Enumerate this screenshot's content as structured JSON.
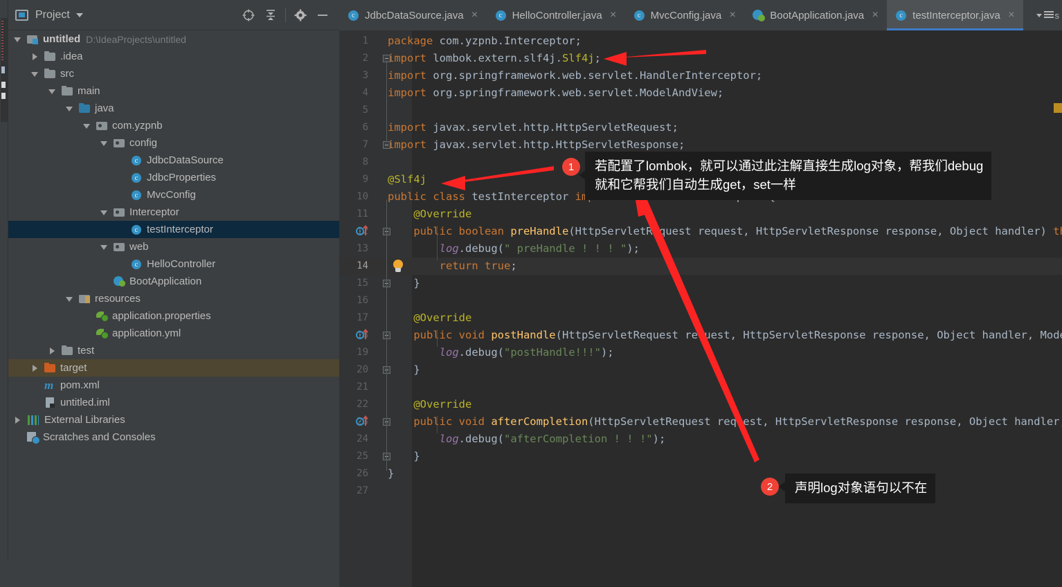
{
  "window": {
    "left_tool_strip_label": "Project"
  },
  "project_panel": {
    "title": "Project",
    "caret_icon": "chevron-down-icon",
    "panel_icon": "project-view-icon",
    "tools": [
      {
        "name": "locate-icon",
        "glyph": "locate"
      },
      {
        "name": "collapse-all-icon",
        "glyph": "collapse"
      },
      {
        "name": "gear-icon",
        "glyph": "gear"
      },
      {
        "name": "minimize-icon",
        "glyph": "minus"
      }
    ],
    "tree": [
      {
        "label": "untitled",
        "sub": "D:\\IdeaProjects\\untitled",
        "indent": 0,
        "arrow": "open",
        "icon": "proj",
        "bold": true,
        "state": "normal"
      },
      {
        "label": ".idea",
        "sub": "",
        "indent": 1,
        "arrow": "closed",
        "icon": "folder",
        "bold": false,
        "state": "normal"
      },
      {
        "label": "src",
        "sub": "",
        "indent": 1,
        "arrow": "open",
        "icon": "folder",
        "bold": false,
        "state": "normal"
      },
      {
        "label": "main",
        "sub": "",
        "indent": 2,
        "arrow": "open",
        "icon": "folder",
        "bold": false,
        "state": "normal"
      },
      {
        "label": "java",
        "sub": "",
        "indent": 3,
        "arrow": "open",
        "icon": "folder-src",
        "bold": false,
        "state": "normal"
      },
      {
        "label": "com.yzpnb",
        "sub": "",
        "indent": 4,
        "arrow": "open",
        "icon": "package",
        "bold": false,
        "state": "normal"
      },
      {
        "label": "config",
        "sub": "",
        "indent": 5,
        "arrow": "open",
        "icon": "package",
        "bold": false,
        "state": "normal"
      },
      {
        "label": "JdbcDataSource",
        "sub": "",
        "indent": 6,
        "arrow": "none",
        "icon": "cls",
        "bold": false,
        "state": "normal"
      },
      {
        "label": "JdbcProperties",
        "sub": "",
        "indent": 6,
        "arrow": "none",
        "icon": "cls",
        "bold": false,
        "state": "normal"
      },
      {
        "label": "MvcConfig",
        "sub": "",
        "indent": 6,
        "arrow": "none",
        "icon": "cls",
        "bold": false,
        "state": "normal"
      },
      {
        "label": "Interceptor",
        "sub": "",
        "indent": 5,
        "arrow": "open",
        "icon": "package",
        "bold": false,
        "state": "normal"
      },
      {
        "label": "testInterceptor",
        "sub": "",
        "indent": 6,
        "arrow": "none",
        "icon": "cls",
        "bold": false,
        "state": "selected"
      },
      {
        "label": "web",
        "sub": "",
        "indent": 5,
        "arrow": "open",
        "icon": "package",
        "bold": false,
        "state": "normal"
      },
      {
        "label": "HelloController",
        "sub": "",
        "indent": 6,
        "arrow": "none",
        "icon": "cls",
        "bold": false,
        "state": "normal"
      },
      {
        "label": "BootApplication",
        "sub": "",
        "indent": 5,
        "arrow": "none",
        "icon": "spring",
        "bold": false,
        "state": "normal"
      },
      {
        "label": "resources",
        "sub": "",
        "indent": 3,
        "arrow": "open",
        "icon": "folder-res",
        "bold": false,
        "state": "normal"
      },
      {
        "label": "application.properties",
        "sub": "",
        "indent": 4,
        "arrow": "none",
        "icon": "leaf",
        "bold": false,
        "state": "normal"
      },
      {
        "label": "application.yml",
        "sub": "",
        "indent": 4,
        "arrow": "none",
        "icon": "leaf",
        "bold": false,
        "state": "normal"
      },
      {
        "label": "test",
        "sub": "",
        "indent": 2,
        "arrow": "closed",
        "icon": "folder",
        "bold": false,
        "state": "normal"
      },
      {
        "label": "target",
        "sub": "",
        "indent": 1,
        "arrow": "closed",
        "icon": "folder-excl",
        "bold": false,
        "state": "highlight"
      },
      {
        "label": "pom.xml",
        "sub": "",
        "indent": 1,
        "arrow": "none",
        "icon": "maven",
        "bold": false,
        "state": "normal"
      },
      {
        "label": "untitled.iml",
        "sub": "",
        "indent": 1,
        "arrow": "none",
        "icon": "iml",
        "bold": false,
        "state": "normal"
      },
      {
        "label": "External Libraries",
        "sub": "",
        "indent": 0,
        "arrow": "closed",
        "icon": "libs",
        "bold": false,
        "state": "normal"
      },
      {
        "label": "Scratches and Consoles",
        "sub": "",
        "indent": 0,
        "arrow": "none",
        "icon": "scratch",
        "bold": false,
        "state": "normal"
      }
    ]
  },
  "editor": {
    "tabs": [
      {
        "label": "JdbcDataSource.java",
        "icon": "cls",
        "active": false,
        "close": "×"
      },
      {
        "label": "HelloController.java",
        "icon": "cls",
        "active": false,
        "close": "×"
      },
      {
        "label": "MvcConfig.java",
        "icon": "cls",
        "active": false,
        "close": "×"
      },
      {
        "label": "BootApplication.java",
        "icon": "spring",
        "active": false,
        "close": "×"
      },
      {
        "label": "testInterceptor.java",
        "icon": "cls",
        "active": true,
        "close": "×"
      }
    ],
    "tab_overflow_label": "s",
    "current_line": 14,
    "lines": [
      {
        "n": "1",
        "segs": [
          {
            "t": "kw",
            "s": "package"
          },
          {
            "t": "id",
            "s": " com.yzpnb.Interceptor;"
          }
        ]
      },
      {
        "n": "2",
        "segs": [
          {
            "t": "kw",
            "s": "import"
          },
          {
            "t": "id",
            "s": " lombok.extern.slf4j."
          },
          {
            "t": "ann",
            "s": "Slf4j"
          },
          {
            "t": "id",
            "s": ";"
          }
        ]
      },
      {
        "n": "3",
        "segs": [
          {
            "t": "kw",
            "s": "import"
          },
          {
            "t": "id",
            "s": " org.springframework.web.servlet.HandlerInterceptor;"
          }
        ]
      },
      {
        "n": "4",
        "segs": [
          {
            "t": "kw",
            "s": "import"
          },
          {
            "t": "id",
            "s": " org.springframework.web.servlet.ModelAndView;"
          }
        ]
      },
      {
        "n": "5",
        "segs": []
      },
      {
        "n": "6",
        "segs": [
          {
            "t": "kw",
            "s": "import"
          },
          {
            "t": "id",
            "s": " javax.servlet.http.HttpServletRequest;"
          }
        ]
      },
      {
        "n": "7",
        "segs": [
          {
            "t": "kw",
            "s": "import"
          },
          {
            "t": "id",
            "s": " javax.servlet.http.HttpServletResponse;"
          }
        ]
      },
      {
        "n": "8",
        "segs": []
      },
      {
        "n": "9",
        "segs": [
          {
            "t": "ann",
            "s": "@Slf4j"
          }
        ]
      },
      {
        "n": "10",
        "segs": [
          {
            "t": "kw",
            "s": "public class"
          },
          {
            "t": "id",
            "s": " testInterceptor "
          },
          {
            "t": "kw",
            "s": "implements"
          },
          {
            "t": "id",
            "s": " HandlerInterceptor {"
          }
        ]
      },
      {
        "n": "11",
        "segs": [
          {
            "t": "ann",
            "s": "    @Override"
          }
        ]
      },
      {
        "n": "12",
        "segs": [
          {
            "t": "kw",
            "s": "    public boolean "
          },
          {
            "t": "fn",
            "s": "preHandle"
          },
          {
            "t": "id",
            "s": "(HttpServletRequest request, HttpServletResponse response, Object handler) "
          },
          {
            "t": "kw",
            "s": "thro"
          }
        ]
      },
      {
        "n": "13",
        "segs": [
          {
            "t": "fld",
            "s": "        log"
          },
          {
            "t": "id",
            "s": ".debug("
          },
          {
            "t": "str",
            "s": "\" preHandle ! ! ! \""
          },
          {
            "t": "id",
            "s": ");"
          }
        ]
      },
      {
        "n": "14",
        "segs": [
          {
            "t": "kw",
            "s": "        return true"
          },
          {
            "t": "id",
            "s": ";"
          }
        ]
      },
      {
        "n": "15",
        "segs": [
          {
            "t": "id",
            "s": "    }"
          }
        ]
      },
      {
        "n": "16",
        "segs": []
      },
      {
        "n": "17",
        "segs": [
          {
            "t": "ann",
            "s": "    @Override"
          }
        ]
      },
      {
        "n": "18",
        "segs": [
          {
            "t": "kw",
            "s": "    public void "
          },
          {
            "t": "fn",
            "s": "postHandle"
          },
          {
            "t": "id",
            "s": "(HttpServletRequest request, HttpServletResponse response, Object handler, ModelAn"
          }
        ]
      },
      {
        "n": "19",
        "segs": [
          {
            "t": "fld",
            "s": "        log"
          },
          {
            "t": "id",
            "s": ".debug("
          },
          {
            "t": "str",
            "s": "\"postHandle!!!\""
          },
          {
            "t": "id",
            "s": ");"
          }
        ]
      },
      {
        "n": "20",
        "segs": [
          {
            "t": "id",
            "s": "    }"
          }
        ]
      },
      {
        "n": "21",
        "segs": []
      },
      {
        "n": "22",
        "segs": [
          {
            "t": "ann",
            "s": "    @Override"
          }
        ]
      },
      {
        "n": "23",
        "segs": [
          {
            "t": "kw",
            "s": "    public void "
          },
          {
            "t": "fn",
            "s": "afterCompletion"
          },
          {
            "t": "id",
            "s": "(HttpServletRequest request, HttpServletResponse response, Object handler, E"
          }
        ]
      },
      {
        "n": "24",
        "segs": [
          {
            "t": "fld",
            "s": "        log"
          },
          {
            "t": "id",
            "s": ".debug("
          },
          {
            "t": "str",
            "s": "\"afterCompletion ! ! !\""
          },
          {
            "t": "id",
            "s": ");"
          }
        ]
      },
      {
        "n": "25",
        "segs": [
          {
            "t": "id",
            "s": "    }"
          }
        ]
      },
      {
        "n": "26",
        "segs": [
          {
            "t": "id",
            "s": "}"
          }
        ]
      },
      {
        "n": "27",
        "segs": []
      }
    ],
    "override_marker_lines": [
      12,
      18,
      23
    ],
    "bulb_line": 14
  },
  "annotations": [
    {
      "badge": "1",
      "lines": [
        "若配置了lombok，就可以通过此注解直接生成log对象，帮我们debug",
        "就和它帮我们自动生成get，set一样"
      ]
    },
    {
      "badge": "2",
      "lines": [
        "声明log对象语句以不在"
      ]
    }
  ],
  "colors": {
    "accent": "#3592c4",
    "badge": "#ef4136",
    "selection": "#0d293e",
    "highlight_row": "#4e4630",
    "editor_bg": "#2b2b2b",
    "panel_bg": "#3c3f41",
    "arrow_red": "#fc2323"
  }
}
